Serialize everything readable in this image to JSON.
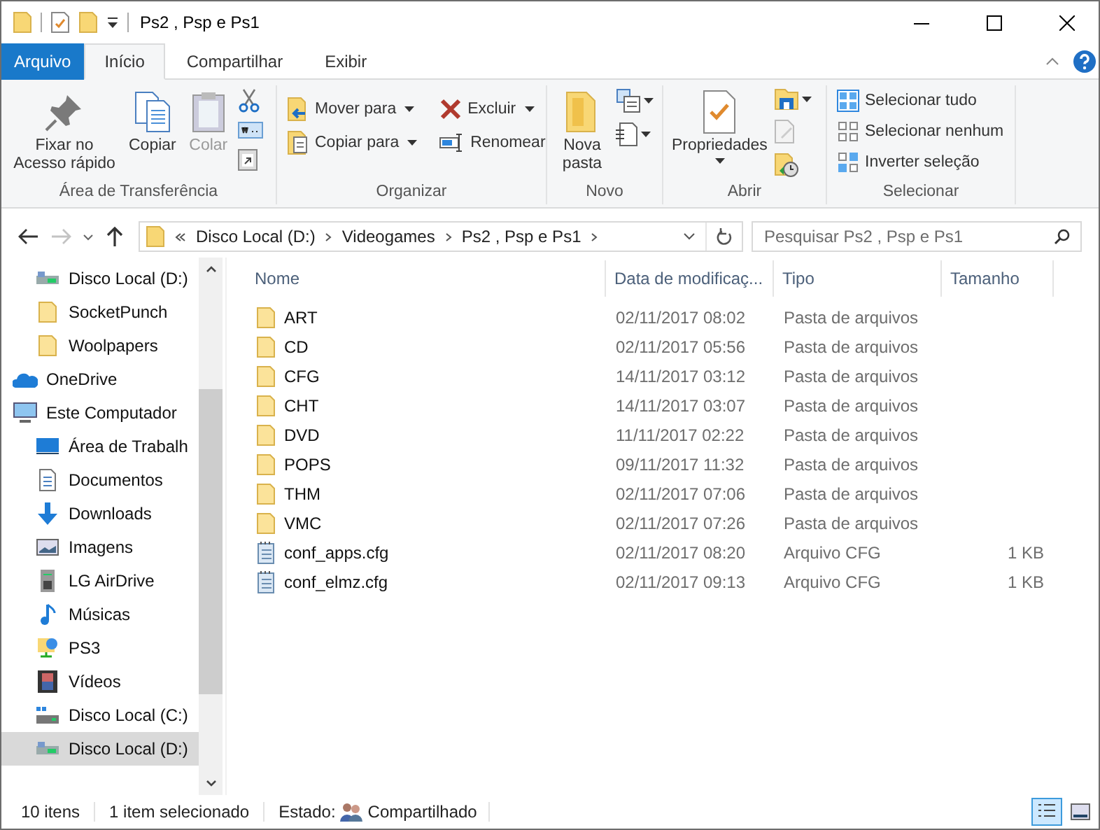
{
  "window": {
    "title": "Ps2 , Psp e Ps1"
  },
  "ribbon_tabs": [
    {
      "label": "Arquivo",
      "kind": "file",
      "selected": false
    },
    {
      "label": "Início",
      "kind": "tab",
      "selected": true
    },
    {
      "label": "Compartilhar",
      "kind": "tab",
      "selected": false
    },
    {
      "label": "Exibir",
      "kind": "tab",
      "selected": false
    }
  ],
  "ribbon": {
    "groups": [
      {
        "label": "Área de Transferência",
        "buttons": [
          {
            "label": "Fixar no Acesso rápido",
            "disabled": false
          },
          {
            "label": "Copiar",
            "disabled": false
          },
          {
            "label": "Colar",
            "disabled": true
          }
        ]
      },
      {
        "label": "Organizar",
        "buttons": [
          {
            "label": "Mover para",
            "disabled": false
          },
          {
            "label": "Copiar para",
            "disabled": false
          },
          {
            "label": "Excluir",
            "disabled": false
          },
          {
            "label": "Renomear",
            "disabled": false
          }
        ]
      },
      {
        "label": "Novo",
        "buttons": [
          {
            "label": "Nova pasta",
            "disabled": false
          }
        ]
      },
      {
        "label": "Abrir",
        "buttons": [
          {
            "label": "Propriedades",
            "disabled": false
          }
        ]
      },
      {
        "label": "Selecionar",
        "buttons": [
          {
            "label": "Selecionar tudo",
            "disabled": false
          },
          {
            "label": "Selecionar nenhum",
            "disabled": false
          },
          {
            "label": "Inverter seleção",
            "disabled": false
          }
        ]
      }
    ]
  },
  "address_bar": {
    "back_disabled": false,
    "forward_disabled": true,
    "crumbs": [
      "Disco Local (D:)",
      "Videogames",
      "Ps2 , Psp e Ps1"
    ]
  },
  "search": {
    "placeholder": "Pesquisar Ps2 , Psp e Ps1"
  },
  "sidebar": {
    "tree": [
      {
        "children": [
          {
            "label": "Disco Local (D:)",
            "kind": "usb-drive",
            "selected": false
          },
          {
            "label": "SocketPunch",
            "kind": "folder",
            "selected": false
          },
          {
            "label": "Woolpapers",
            "kind": "folder",
            "selected": false
          }
        ]
      },
      {
        "label": "OneDrive",
        "kind": "cloud",
        "selected": false
      },
      {
        "label": "Este Computador",
        "kind": "computer",
        "selected": false,
        "children": [
          {
            "label": "Área de Trabalh",
            "kind": "desktop",
            "selected": false
          },
          {
            "label": "Documentos",
            "kind": "documents",
            "selected": false
          },
          {
            "label": "Downloads",
            "kind": "downloads",
            "selected": false
          },
          {
            "label": "Imagens",
            "kind": "images",
            "selected": false
          },
          {
            "label": "LG AirDrive",
            "kind": "tower",
            "selected": false
          },
          {
            "label": "Músicas",
            "kind": "music",
            "selected": false
          },
          {
            "label": "PS3",
            "kind": "network",
            "selected": false
          },
          {
            "label": "Vídeos",
            "kind": "videos",
            "selected": false
          },
          {
            "label": "Disco Local (C:)",
            "kind": "system-drive",
            "selected": false
          },
          {
            "label": "Disco Local (D:)",
            "kind": "usb-drive",
            "selected": true
          }
        ]
      }
    ]
  },
  "table": {
    "columns": [
      "Nome",
      "Data de modificaç...",
      "Tipo",
      "Tamanho"
    ],
    "rows": [
      {
        "kind": "folder",
        "name": "ART",
        "date": "02/11/2017 08:02",
        "type": "Pasta de arquivos",
        "selected": false
      },
      {
        "kind": "folder",
        "name": "CD",
        "date": "02/11/2017 05:56",
        "type": "Pasta de arquivos",
        "selected": false
      },
      {
        "kind": "folder",
        "name": "CFG",
        "date": "14/11/2017 03:12",
        "type": "Pasta de arquivos",
        "selected": false
      },
      {
        "kind": "folder",
        "name": "CHT",
        "date": "14/11/2017 03:07",
        "type": "Pasta de arquivos",
        "selected": false
      },
      {
        "kind": "folder",
        "name": "DVD",
        "date": "11/11/2017 02:22",
        "type": "Pasta de arquivos",
        "selected": false
      },
      {
        "kind": "folder",
        "name": "POPS",
        "date": "09/11/2017 11:32",
        "type": "Pasta de arquivos",
        "selected": false
      },
      {
        "kind": "folder",
        "name": "THM",
        "date": "02/11/2017 07:06",
        "type": "Pasta de arquivos",
        "selected": false
      },
      {
        "kind": "folder",
        "name": "VMC",
        "date": "02/11/2017 07:26",
        "type": "Pasta de arquivos",
        "selected": false
      },
      {
        "kind": "file",
        "name": "conf_apps.cfg",
        "date": "02/11/2017 08:20",
        "type": "Arquivo CFG",
        "size": "1 KB",
        "selected": false
      },
      {
        "kind": "file",
        "name": "conf_elmz.cfg",
        "date": "02/11/2017 09:13",
        "type": "Arquivo CFG",
        "size": "1 KB",
        "selected": false
      }
    ]
  },
  "status_bar": {
    "item_count": "10 itens",
    "selection": "1 item selecionado",
    "state_label": "Estado:",
    "state": "Compartilhado",
    "views": [
      {
        "kind": "details",
        "selected": true
      },
      {
        "kind": "tiles",
        "selected": false
      }
    ]
  }
}
